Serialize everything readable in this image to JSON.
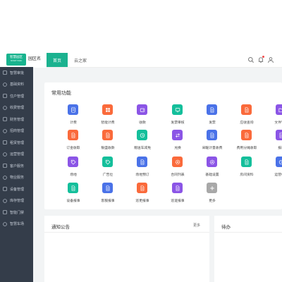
{
  "brand": {
    "logo_text": "智慧园区",
    "logo_sub": "SMART PARK",
    "park_label": "园区名"
  },
  "tabs": [
    {
      "label": "首页"
    },
    {
      "label": "云之家"
    }
  ],
  "sidebar": {
    "items": [
      {
        "label": "智慧审批"
      },
      {
        "label": "基础资料"
      },
      {
        "label": "住户管理"
      },
      {
        "label": "收费管理"
      },
      {
        "label": "财务管理"
      },
      {
        "label": "招商管理"
      },
      {
        "label": "租赁管理"
      },
      {
        "label": "运营管理"
      },
      {
        "label": "客户服务"
      },
      {
        "label": "物业服务"
      },
      {
        "label": "设备管理"
      },
      {
        "label": "库存管理"
      },
      {
        "label": "智能门禁"
      },
      {
        "label": "智慧车场"
      }
    ]
  },
  "common": {
    "title": "常用功能",
    "items": [
      {
        "label": "计费",
        "color": "#4a72e8",
        "icon": "receipt"
      },
      {
        "label": "智能计费",
        "color": "#fa6a3b",
        "icon": "grid"
      },
      {
        "label": "收款",
        "color": "#8b55e6",
        "icon": "wallet"
      },
      {
        "label": "发票审核",
        "color": "#14bf9b",
        "icon": "monitor"
      },
      {
        "label": "发票",
        "color": "#4a72e8",
        "icon": "doc"
      },
      {
        "label": "应收查询",
        "color": "#fa6a3b",
        "icon": "doc"
      },
      {
        "label": "文件管理",
        "color": "#8b55e6",
        "icon": "folder"
      },
      {
        "label": "订金收取",
        "color": "#fa6a3b",
        "icon": "doc"
      },
      {
        "label": "银盛收款",
        "color": "#fa6a3b",
        "icon": "doc"
      },
      {
        "label": "赠送车减免",
        "color": "#14bf9b",
        "icon": "clock"
      },
      {
        "label": "兑换",
        "color": "#8b55e6",
        "icon": "swap"
      },
      {
        "label": "采暖计量收费",
        "color": "#4a72e8",
        "icon": "doc"
      },
      {
        "label": "费用分摊收取",
        "color": "#fa6a3b",
        "icon": "doc"
      },
      {
        "label": "报表",
        "color": "#8b55e6",
        "icon": "doc"
      },
      {
        "label": "场地",
        "color": "#8b55e6",
        "icon": "tag"
      },
      {
        "label": "广告位",
        "color": "#14bf9b",
        "icon": "tag"
      },
      {
        "label": "场地预订",
        "color": "#4a72e8",
        "icon": "doc"
      },
      {
        "label": "合同列表",
        "color": "#fa6a3b",
        "icon": "gear"
      },
      {
        "label": "基础设置",
        "color": "#8b55e6",
        "icon": "gear"
      },
      {
        "label": "房间资料",
        "color": "#14bf9b",
        "icon": "doc"
      },
      {
        "label": "运营中心",
        "color": "#4a72e8",
        "icon": "clock"
      },
      {
        "label": "设备报事",
        "color": "#14bf9b",
        "icon": "doc"
      },
      {
        "label": "客服报事",
        "color": "#4a72e8",
        "icon": "doc"
      },
      {
        "label": "巡更报事",
        "color": "#fa6a3b",
        "icon": "doc"
      },
      {
        "label": "巡逻报事",
        "color": "#8b55e6",
        "icon": "doc"
      },
      {
        "label": "更多",
        "color": "#a8a8a8",
        "icon": "plus"
      }
    ]
  },
  "notice": {
    "title": "通知公告",
    "more": "更多"
  },
  "todo": {
    "title": "待办"
  }
}
